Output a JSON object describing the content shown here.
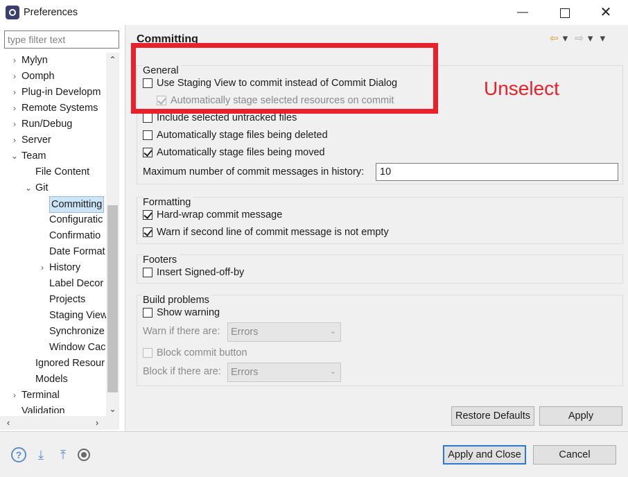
{
  "window": {
    "title": "Preferences",
    "minimize_glyph": "—",
    "close_glyph": "✕"
  },
  "sidebar": {
    "filter_placeholder": "type filter text",
    "tree": [
      {
        "label": "Mylyn",
        "twisty": "›"
      },
      {
        "label": "Oomph",
        "twisty": "›"
      },
      {
        "label": "Plug-in Developm",
        "twisty": "›"
      },
      {
        "label": "Remote Systems",
        "twisty": "›"
      },
      {
        "label": "Run/Debug",
        "twisty": "›"
      },
      {
        "label": "Server",
        "twisty": "›"
      },
      {
        "label": "Team",
        "twisty": "⌄"
      },
      {
        "label": "File Content",
        "twisty": ""
      },
      {
        "label": "Git",
        "twisty": "⌄"
      },
      {
        "label": "Committing",
        "twisty": "",
        "selected": true
      },
      {
        "label": "Configuratic",
        "twisty": ""
      },
      {
        "label": "Confirmatio",
        "twisty": ""
      },
      {
        "label": "Date Format",
        "twisty": ""
      },
      {
        "label": "History",
        "twisty": "›"
      },
      {
        "label": "Label Decor",
        "twisty": ""
      },
      {
        "label": "Projects",
        "twisty": ""
      },
      {
        "label": "Staging View",
        "twisty": ""
      },
      {
        "label": "Synchronize",
        "twisty": ""
      },
      {
        "label": "Window Cac",
        "twisty": ""
      },
      {
        "label": "Ignored Resour",
        "twisty": ""
      },
      {
        "label": "Models",
        "twisty": ""
      },
      {
        "label": "Terminal",
        "twisty": "›"
      },
      {
        "label": "Validation",
        "twisty": ""
      }
    ],
    "scroll_up": "⌃",
    "scroll_down": "⌄",
    "scroll_left": "‹",
    "scroll_right": "›"
  },
  "page": {
    "title": "Committing",
    "nav_back": "⇦",
    "nav_back_menu": "▾",
    "nav_forward": "⇨",
    "nav_forward_menu": "▾",
    "view_menu": "▾",
    "general": {
      "label": "General",
      "use_staging_view": {
        "label": "Use Staging View to commit instead of Commit Dialog",
        "checked": false
      },
      "auto_stage_selected": {
        "label": "Automatically stage selected resources on commit",
        "checked": true,
        "disabled": true
      },
      "include_untracked": {
        "label": "Include selected untracked files",
        "checked": false
      },
      "auto_stage_deleted": {
        "label": "Automatically stage files being deleted",
        "checked": false
      },
      "auto_stage_moved": {
        "label": "Automatically stage files being moved",
        "checked": true
      },
      "max_messages_label": "Maximum number of commit messages in history:",
      "max_messages_value": "10"
    },
    "formatting": {
      "label": "Formatting",
      "hard_wrap": {
        "label": "Hard-wrap commit message",
        "checked": true
      },
      "warn_second_line": {
        "label": "Warn if second line of commit message is not empty",
        "checked": true
      }
    },
    "footers": {
      "label": "Footers",
      "signed_off": {
        "label": "Insert Signed-off-by",
        "checked": false
      }
    },
    "build_problems": {
      "label": "Build problems",
      "show_warning": {
        "label": "Show warning",
        "checked": false
      },
      "warn_if_label": "Warn if there are:",
      "warn_if_value": "Errors",
      "block_commit": {
        "label": "Block commit button",
        "checked": false,
        "disabled": true
      },
      "block_if_label": "Block if there are:",
      "block_if_value": "Errors"
    },
    "restore_defaults_label": "Restore Defaults",
    "apply_label": "Apply"
  },
  "annotation": {
    "text": "Unselect",
    "color": "#e8212b"
  },
  "footer": {
    "help_glyph": "?",
    "import_glyph": "⤓",
    "export_glyph": "⤒",
    "apply_close_label": "Apply and Close",
    "cancel_label": "Cancel"
  }
}
